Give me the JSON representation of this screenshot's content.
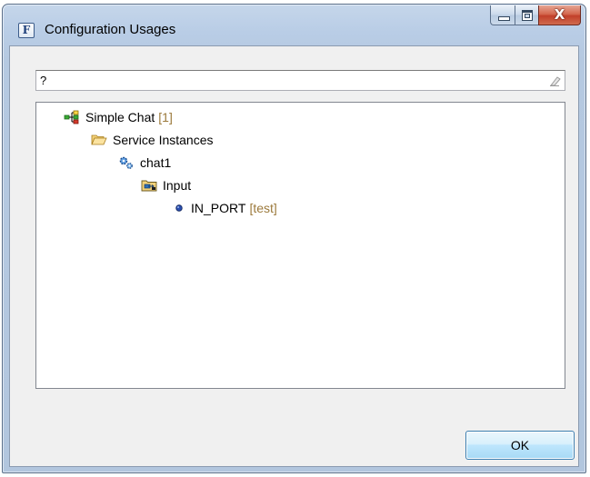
{
  "window": {
    "title": "Configuration Usages",
    "app_icon_letter": "F",
    "close_glyph": "X"
  },
  "search": {
    "value": "?",
    "placeholder": ""
  },
  "tree": {
    "root": {
      "label": "Simple Chat",
      "usage": "[1]",
      "icon": "model-icon"
    },
    "folder": {
      "label": "Service Instances",
      "icon": "folder-open-icon"
    },
    "instance": {
      "label": "chat1",
      "icon": "gears-icon"
    },
    "group": {
      "label": "Input",
      "icon": "input-folder-icon"
    },
    "leaf": {
      "label": "IN_PORT",
      "usage": "[test]",
      "icon": "port-dot-icon"
    }
  },
  "buttons": {
    "ok_label": "OK"
  },
  "colors": {
    "usage_text": "#9c7a3c",
    "window_frame": "#b9cde6",
    "client_bg": "#f0f0f0"
  }
}
